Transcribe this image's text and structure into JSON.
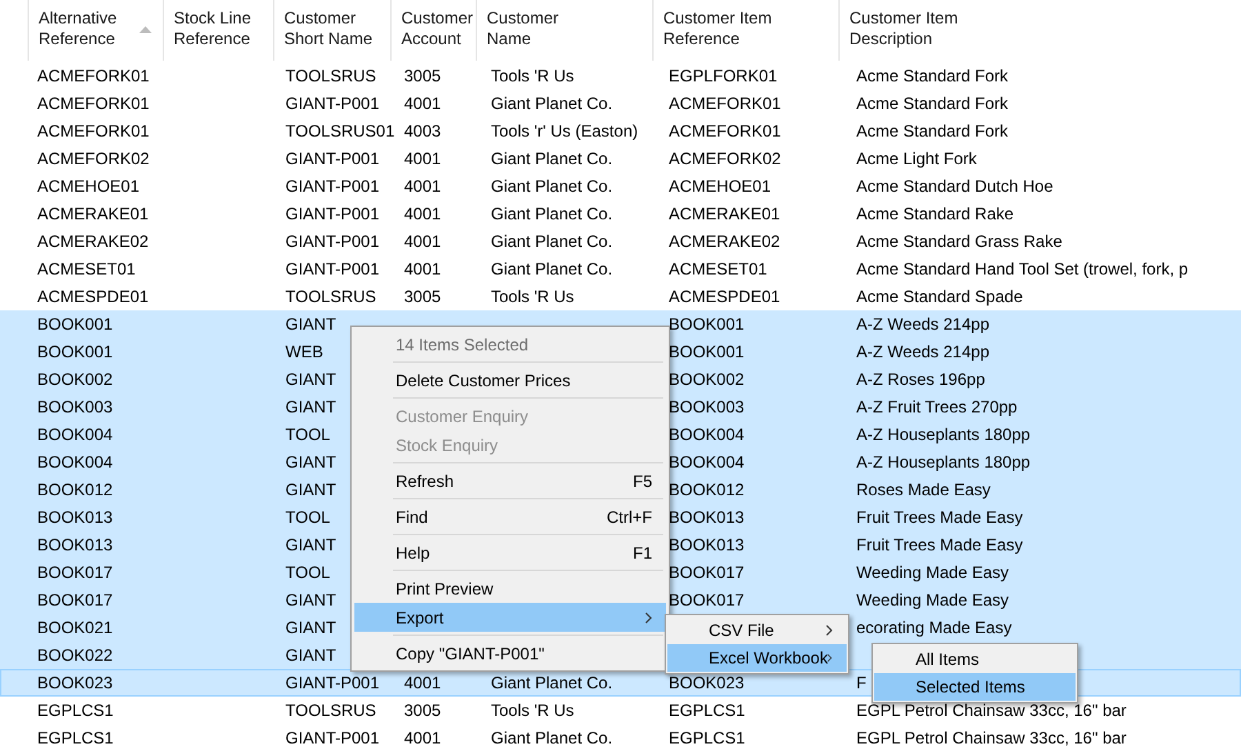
{
  "table": {
    "columns": [
      {
        "label_lines": [
          "Alternative",
          "Reference"
        ],
        "sorted": true
      },
      {
        "label_lines": [
          "Stock Line",
          "Reference"
        ],
        "sorted": false
      },
      {
        "label_lines": [
          "Customer",
          "Short Name"
        ],
        "sorted": false
      },
      {
        "label_lines": [
          "Customer",
          "Account"
        ],
        "sorted": false
      },
      {
        "label_lines": [
          "Customer",
          "Name"
        ],
        "sorted": false
      },
      {
        "label_lines": [
          "Customer Item",
          "Reference"
        ],
        "sorted": false
      },
      {
        "label_lines": [
          "Customer Item",
          "Description"
        ],
        "sorted": false
      }
    ],
    "rows": [
      {
        "alt": "ACMEFORK01",
        "short": "TOOLSRUS",
        "account": "3005",
        "name": "Tools 'R Us",
        "ref": "EGPLFORK01",
        "desc": "Acme Standard Fork",
        "selected": false,
        "focused": false
      },
      {
        "alt": "ACMEFORK01",
        "short": "GIANT-P001",
        "account": "4001",
        "name": "Giant Planet Co.",
        "ref": "ACMEFORK01",
        "desc": "Acme Standard Fork",
        "selected": false,
        "focused": false
      },
      {
        "alt": "ACMEFORK01",
        "short": "TOOLSRUS01",
        "account": "4003",
        "name": "Tools 'r' Us (Easton)",
        "ref": "ACMEFORK01",
        "desc": "Acme Standard Fork",
        "selected": false,
        "focused": false
      },
      {
        "alt": "ACMEFORK02",
        "short": "GIANT-P001",
        "account": "4001",
        "name": "Giant Planet Co.",
        "ref": "ACMEFORK02",
        "desc": "Acme Light Fork",
        "selected": false,
        "focused": false
      },
      {
        "alt": "ACMEHOE01",
        "short": "GIANT-P001",
        "account": "4001",
        "name": "Giant Planet Co.",
        "ref": "ACMEHOE01",
        "desc": "Acme Standard Dutch Hoe",
        "selected": false,
        "focused": false
      },
      {
        "alt": "ACMERAKE01",
        "short": "GIANT-P001",
        "account": "4001",
        "name": "Giant Planet Co.",
        "ref": "ACMERAKE01",
        "desc": "Acme Standard Rake",
        "selected": false,
        "focused": false
      },
      {
        "alt": "ACMERAKE02",
        "short": "GIANT-P001",
        "account": "4001",
        "name": "Giant Planet Co.",
        "ref": "ACMERAKE02",
        "desc": "Acme Standard Grass Rake",
        "selected": false,
        "focused": false
      },
      {
        "alt": "ACMESET01",
        "short": "GIANT-P001",
        "account": "4001",
        "name": "Giant Planet Co.",
        "ref": "ACMESET01",
        "desc": "Acme Standard Hand Tool Set (trowel, fork, p",
        "selected": false,
        "focused": false
      },
      {
        "alt": "ACMESPDE01",
        "short": "TOOLSRUS",
        "account": "3005",
        "name": "Tools 'R Us",
        "ref": "ACMESPDE01",
        "desc": "Acme Standard Spade",
        "selected": false,
        "focused": false
      },
      {
        "alt": "BOOK001",
        "short": "GIANT",
        "ref": "BOOK001",
        "desc": "A-Z Weeds 214pp",
        "selected": true,
        "focused": false
      },
      {
        "alt": "BOOK001",
        "short": "WEB",
        "ref": "BOOK001",
        "desc": "A-Z Weeds 214pp",
        "selected": true,
        "focused": false
      },
      {
        "alt": "BOOK002",
        "short": "GIANT",
        "ref": "BOOK002",
        "desc": "A-Z Roses 196pp",
        "selected": true,
        "focused": false
      },
      {
        "alt": "BOOK003",
        "short": "GIANT",
        "ref": "BOOK003",
        "desc": "A-Z Fruit Trees 270pp",
        "selected": true,
        "focused": false
      },
      {
        "alt": "BOOK004",
        "short": "TOOL",
        "ref": "BOOK004",
        "desc": "A-Z Houseplants 180pp",
        "selected": true,
        "focused": false
      },
      {
        "alt": "BOOK004",
        "short": "GIANT",
        "ref": "BOOK004",
        "desc": "A-Z Houseplants 180pp",
        "selected": true,
        "focused": false
      },
      {
        "alt": "BOOK012",
        "short": "GIANT",
        "ref": "BOOK012",
        "desc": "Roses Made Easy",
        "selected": true,
        "focused": false
      },
      {
        "alt": "BOOK013",
        "short": "TOOL",
        "ref": "BOOK013",
        "desc": "Fruit Trees Made Easy",
        "selected": true,
        "focused": false
      },
      {
        "alt": "BOOK013",
        "short": "GIANT",
        "ref": "BOOK013",
        "desc": "Fruit Trees Made Easy",
        "selected": true,
        "focused": false
      },
      {
        "alt": "BOOK017",
        "short": "TOOL",
        "ref": "BOOK017",
        "desc": "Weeding Made Easy",
        "selected": true,
        "focused": false
      },
      {
        "alt": "BOOK017",
        "short": "GIANT",
        "ref": "BOOK017",
        "desc": "Weeding Made Easy",
        "selected": true,
        "focused": false
      },
      {
        "alt": "BOOK021",
        "short": "GIANT",
        "desc": "ecorating Made Easy",
        "selected": true,
        "focused": false
      },
      {
        "alt": "BOOK022",
        "short": "GIANT",
        "selected": true,
        "focused": false
      },
      {
        "alt": "BOOK023",
        "short": "GIANT-P001",
        "account": "4001",
        "name": "Giant Planet Co.",
        "ref": "BOOK023",
        "desc": "F",
        "selected": true,
        "focused": true
      },
      {
        "alt": "EGPLCS1",
        "short": "TOOLSRUS",
        "account": "3005",
        "name": "Tools 'R Us",
        "ref": "EGPLCS1",
        "desc": "EGPL Petrol Chainsaw 33cc, 16\" bar",
        "selected": false,
        "focused": false
      },
      {
        "alt": "EGPLCS1",
        "short": "GIANT-P001",
        "account": "4001",
        "name": "Giant Planet Co.",
        "ref": "EGPLCS1",
        "desc": "EGPL Petrol Chainsaw 33cc, 16\" bar",
        "selected": false,
        "focused": false
      }
    ]
  },
  "context_menu": {
    "items": [
      {
        "kind": "header",
        "label": "14 Items Selected"
      },
      {
        "kind": "separator"
      },
      {
        "kind": "item",
        "label": "Delete Customer Prices",
        "disabled": false,
        "selected": false,
        "submenu": false
      },
      {
        "kind": "separator"
      },
      {
        "kind": "item",
        "label": "Customer Enquiry",
        "disabled": true,
        "selected": false,
        "submenu": false
      },
      {
        "kind": "item",
        "label": "Stock Enquiry",
        "disabled": true,
        "selected": false,
        "submenu": false
      },
      {
        "kind": "separator"
      },
      {
        "kind": "item",
        "label": "Refresh",
        "shortcut": "F5",
        "disabled": false,
        "selected": false,
        "submenu": false
      },
      {
        "kind": "separator"
      },
      {
        "kind": "item",
        "label": "Find",
        "shortcut": "Ctrl+F",
        "disabled": false,
        "selected": false,
        "submenu": false
      },
      {
        "kind": "separator"
      },
      {
        "kind": "item",
        "label": "Help",
        "shortcut": "F1",
        "disabled": false,
        "selected": false,
        "submenu": false
      },
      {
        "kind": "separator"
      },
      {
        "kind": "item",
        "label": "Print Preview",
        "disabled": false,
        "selected": false,
        "submenu": false
      },
      {
        "kind": "item",
        "label": "Export",
        "disabled": false,
        "selected": true,
        "submenu": true
      },
      {
        "kind": "separator"
      },
      {
        "kind": "item",
        "label": "Copy \"GIANT-P001\"",
        "disabled": false,
        "selected": false,
        "submenu": false
      }
    ]
  },
  "export_submenu": {
    "items": [
      {
        "kind": "item",
        "label": "CSV File",
        "disabled": false,
        "selected": false,
        "submenu": true
      },
      {
        "kind": "item",
        "label": "Excel Workbook",
        "disabled": false,
        "selected": true,
        "submenu": true
      }
    ]
  },
  "excel_submenu": {
    "items": [
      {
        "kind": "item",
        "label": "All Items",
        "disabled": false,
        "selected": false,
        "submenu": false
      },
      {
        "kind": "item",
        "label": "Selected Items",
        "disabled": false,
        "selected": true,
        "submenu": false
      }
    ]
  }
}
